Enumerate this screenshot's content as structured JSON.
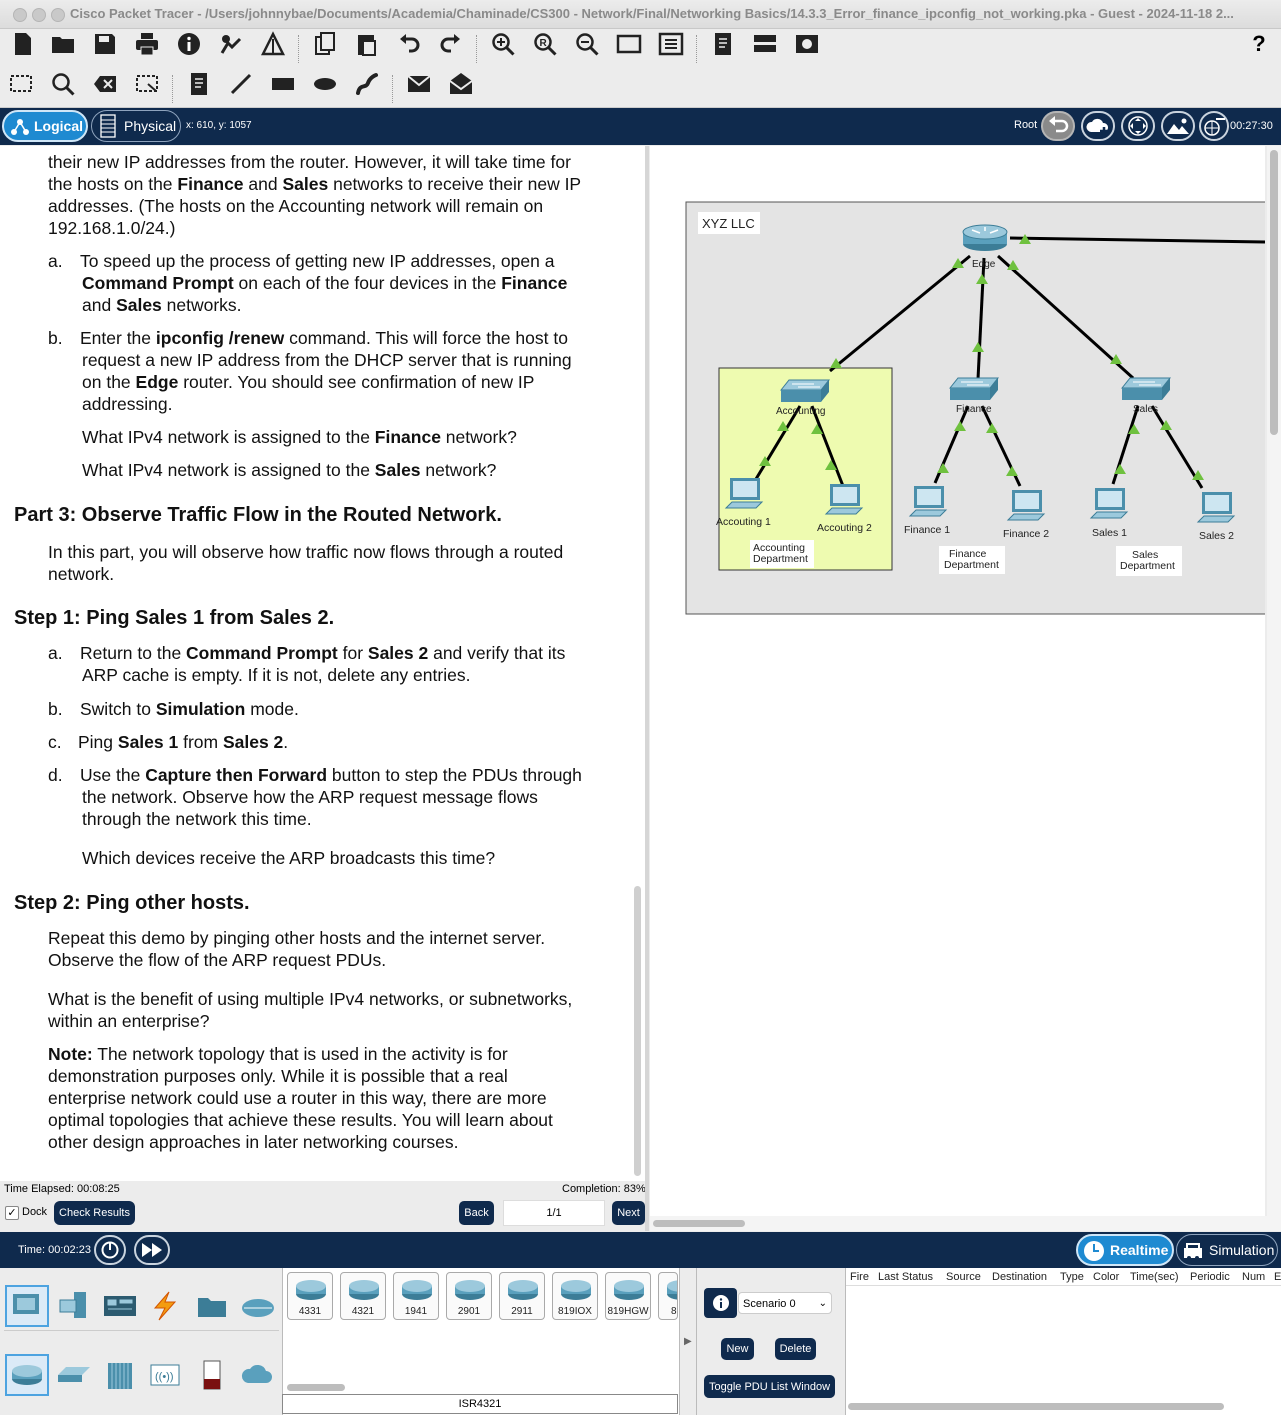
{
  "window": {
    "title": "Cisco Packet Tracer - /Users/johnnybae/Documents/Academia/Chaminade/CS300 - Network/Final/Networking Basics/14.3.3_Error_finance_ipconfig_not_working.pka - Guest - 2024-11-18 2..."
  },
  "toolbar": {
    "help": "?"
  },
  "nav": {
    "logical": "Logical",
    "physical": "Physical",
    "coords": "x: 610, y: 1057",
    "root": "Root",
    "clock": "00:27:30"
  },
  "instructions": {
    "lines": [
      "their new IP addresses from the router. However, it will take time for",
      "the hosts on the Finance and Sales networks to receive their new IP",
      "addresses. (The hosts on the Accounting network will remain on",
      "192.168.1.0/24.)"
    ],
    "a1": "a.",
    "a1_lines": [
      "To speed up the process of getting new IP addresses, open a",
      "Command Prompt on each of the four devices in the Finance",
      "and Sales networks."
    ],
    "b1": "b.",
    "b1_lines": [
      "Enter the ipconfig /renew command. This will force the host to",
      "request a new IP address from the DHCP server that is running",
      "on the Edge router. You should see confirmation of new IP",
      "addressing."
    ],
    "q_finance": "What IPv4 network is assigned to the Finance network?",
    "q_sales": "What IPv4 network is assigned to the Sales network?",
    "part3": "Part 3: Observe Traffic Flow in the Routed Network.",
    "part3_lines": [
      "In this part, you will observe how traffic now flows through a routed",
      "network."
    ],
    "step1": "Step 1: Ping Sales 1 from Sales 2.",
    "s1a": "a.",
    "s1a_lines": [
      "Return to the Command Prompt for Sales 2 and verify that its",
      "ARP cache is empty. If it is not, delete any entries."
    ],
    "s1b": "b.",
    "s1b_line": "Switch to Simulation mode.",
    "s1c": "c.",
    "s1c_line": "Ping Sales 1 from Sales 2.",
    "s1d": "d.",
    "s1d_lines": [
      "Use the Capture then Forward button to step the PDUs through",
      "the network. Observe how the ARP request message flows",
      "through the network this time."
    ],
    "q_arp": "Which devices receive the ARP broadcasts this time?",
    "step2": "Step 2: Ping other hosts.",
    "step2_lines": [
      "Repeat this demo by pinging other hosts and the internet server.",
      "Observe the flow of the ARP request PDUs."
    ],
    "q_benefit": [
      "What is the benefit of using multiple IPv4 networks, or subnetworks,",
      "within an enterprise?"
    ],
    "note_label": "Note:",
    "note_lines": [
      " The network topology that is used in the activity is for",
      "demonstration purposes only. While it is possible that a real",
      "enterprise network could use a router in this way, there are more",
      "optimal topologies that achieve these results. You will learn about",
      "other design approaches in later networking courses."
    ]
  },
  "activity": {
    "time_elapsed": "Time Elapsed: 00:08:25",
    "completion": "Completion: 83%",
    "dock": "Dock",
    "check_results": "Check Results",
    "back": "Back",
    "page": "1/1",
    "next": "Next"
  },
  "topology": {
    "cluster": "XYZ LLC",
    "router": "Edge",
    "switches": [
      "Accounting",
      "Finance",
      "Sales"
    ],
    "hosts": [
      "Accouting 1",
      "Accouting 2",
      "Finance 1",
      "Finance 2",
      "Sales 1",
      "Sales 2"
    ],
    "dept_accounting": [
      "Accounting",
      "Department"
    ],
    "dept_finance": [
      "Finance",
      "Department"
    ],
    "dept_sales": [
      "Sales",
      "Department"
    ]
  },
  "simbar": {
    "time": "Time: 00:02:23",
    "realtime": "Realtime",
    "simulation": "Simulation"
  },
  "devices": {
    "models": [
      "4331",
      "4321",
      "1941",
      "2901",
      "2911",
      "819IOX",
      "819HGW",
      "8"
    ],
    "selected_model": "ISR4321"
  },
  "scenario": {
    "name": "Scenario 0",
    "new": "New",
    "delete": "Delete",
    "toggle": "Toggle PDU List Window"
  },
  "pdu_columns": [
    "Fire",
    "Last Status",
    "Source",
    "Destination",
    "Type",
    "Color",
    "Time(sec)",
    "Periodic",
    "Num",
    "E"
  ],
  "colors": {
    "navy": "#0f2a4d",
    "accent": "#1e8ad1",
    "link_up": "#6fc13f",
    "accounting_zone": "#eefbb0"
  }
}
